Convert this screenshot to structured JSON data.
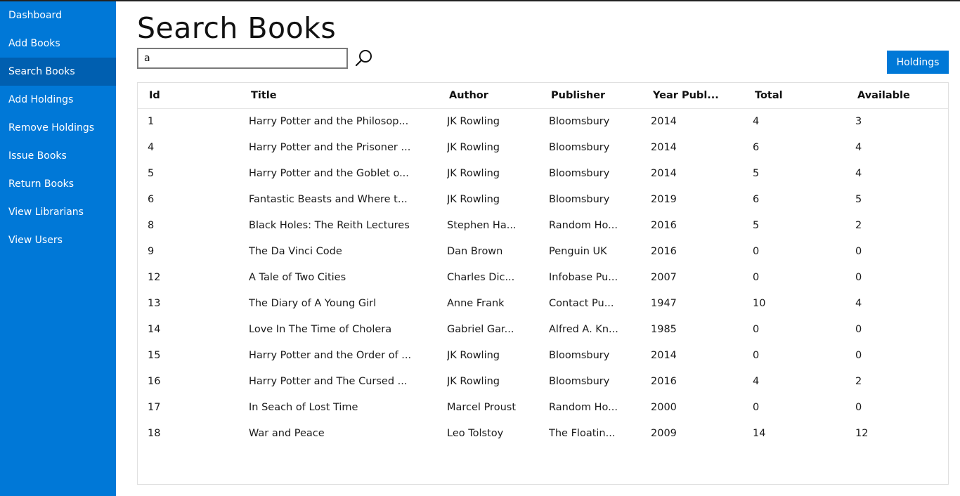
{
  "sidebar": {
    "items": [
      {
        "label": "Dashboard",
        "name": "sidebar-item-dashboard",
        "active": false
      },
      {
        "label": "Add Books",
        "name": "sidebar-item-add-books",
        "active": false
      },
      {
        "label": "Search Books",
        "name": "sidebar-item-search-books",
        "active": true
      },
      {
        "label": "Add Holdings",
        "name": "sidebar-item-add-holdings",
        "active": false
      },
      {
        "label": "Remove Holdings",
        "name": "sidebar-item-remove-holdings",
        "active": false
      },
      {
        "label": "Issue Books",
        "name": "sidebar-item-issue-books",
        "active": false
      },
      {
        "label": "Return Books",
        "name": "sidebar-item-return-books",
        "active": false
      },
      {
        "label": "View Librarians",
        "name": "sidebar-item-view-librarians",
        "active": false
      },
      {
        "label": "View Users",
        "name": "sidebar-item-view-users",
        "active": false
      }
    ]
  },
  "main": {
    "title": "Search Books",
    "search": {
      "value": "a",
      "icon": "search-icon"
    },
    "holdings_label": "Holdings"
  },
  "table": {
    "columns": [
      "Id",
      "Title",
      "Author",
      "Publisher",
      "Year Publ...",
      "Total",
      "Available"
    ],
    "rows": [
      [
        "1",
        "Harry Potter and the Philosop...",
        "JK Rowling",
        "Bloomsbury",
        "2014",
        "4",
        "3"
      ],
      [
        "4",
        "Harry Potter and the Prisoner ...",
        "JK Rowling",
        "Bloomsbury",
        "2014",
        "6",
        "4"
      ],
      [
        "5",
        "Harry Potter and the Goblet o...",
        "JK Rowling",
        "Bloomsbury",
        "2014",
        "5",
        "4"
      ],
      [
        "6",
        "Fantastic Beasts and Where t...",
        "JK Rowling",
        "Bloomsbury",
        "2019",
        "6",
        "5"
      ],
      [
        "8",
        "Black Holes: The Reith Lectures",
        "Stephen Ha...",
        "Random Ho...",
        "2016",
        "5",
        "2"
      ],
      [
        "9",
        "The Da Vinci Code",
        "Dan Brown",
        "Penguin UK",
        "2016",
        "0",
        "0"
      ],
      [
        "12",
        "A Tale of Two Cities",
        "Charles Dic...",
        "Infobase Pu...",
        "2007",
        "0",
        "0"
      ],
      [
        "13",
        "The Diary of A Young Girl",
        "Anne Frank",
        "Contact Pu...",
        "1947",
        "10",
        "4"
      ],
      [
        "14",
        "Love In The Time of Cholera",
        "Gabriel Gar...",
        "Alfred A. Kn...",
        "1985",
        "0",
        "0"
      ],
      [
        "15",
        "Harry Potter and the Order of ...",
        "JK Rowling",
        "Bloomsbury",
        "2014",
        "0",
        "0"
      ],
      [
        "16",
        "Harry Potter and The Cursed ...",
        "JK Rowling",
        "Bloomsbury",
        "2016",
        "4",
        "2"
      ],
      [
        "17",
        "In Seach of Lost Time",
        "Marcel Proust",
        "Random Ho...",
        "2000",
        "0",
        "0"
      ],
      [
        "18",
        "War and Peace",
        "Leo Tolstoy",
        "The Floatin...",
        "2009",
        "14",
        "12"
      ]
    ]
  },
  "colors": {
    "accent": "#0078d7",
    "accent_active": "#005fb0"
  }
}
